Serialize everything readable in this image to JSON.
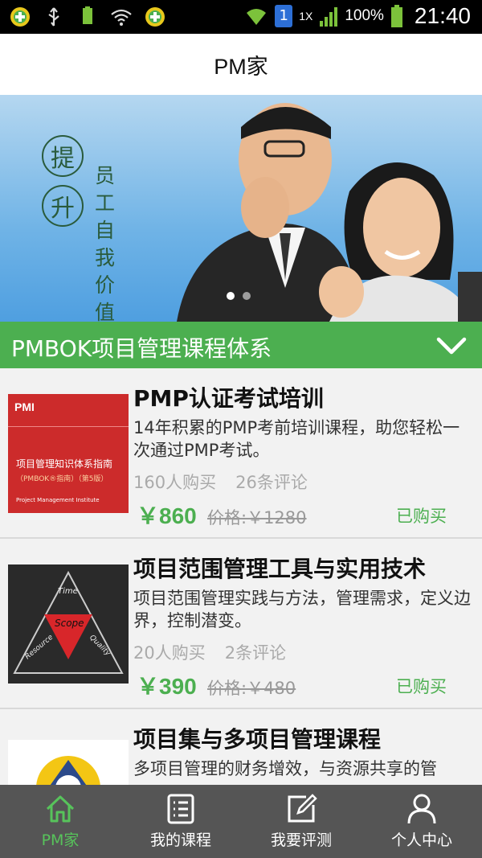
{
  "status_bar": {
    "battery_pct": "100%",
    "time": "21:40",
    "network": "1X",
    "sim": "1",
    "small_battery_label": "100%"
  },
  "header": {
    "title": "PM家"
  },
  "banner": {
    "circle_chars": [
      "提",
      "升"
    ],
    "vertical_chars": [
      "员",
      "工",
      "自",
      "我",
      "价",
      "值"
    ],
    "slide_count": 2,
    "active_slide": 0
  },
  "section": {
    "title": "PMBOK项目管理课程体系"
  },
  "courses": [
    {
      "title": "PMP认证考试培训",
      "description": "14年积累的PMP考前培训课程，助您轻松一次通过PMP考试。",
      "buyers": "160人购买",
      "reviews": "26条评论",
      "price": "￥860",
      "original_price": "价格:￥1280",
      "status": "已购买",
      "thumb": {
        "logo": "PMI",
        "title": "项目管理知识体系指南",
        "subtitle": "（PMBOK®指南）（第5版）",
        "publisher": "Project Management Institute"
      }
    },
    {
      "title": "项目范围管理工具与实用技术",
      "description": "项目范围管理实践与方法，管理需求，定义边界，控制潜变。",
      "buyers": "20人购买",
      "reviews": "2条评论",
      "price": "￥390",
      "original_price": "价格:￥480",
      "status": "已购买",
      "thumb": {
        "labels": [
          "Time",
          "Scope",
          "Resource",
          "Quality"
        ]
      }
    },
    {
      "title": "项目集与多项目管理课程",
      "description": "多项目管理的财务增效，与资源共享的管",
      "buyers": "",
      "reviews": "",
      "price": "",
      "original_price": "",
      "status": "",
      "thumb": {}
    }
  ],
  "bottom_nav": [
    {
      "label": "PM家",
      "icon": "home-icon",
      "active": true
    },
    {
      "label": "我的课程",
      "icon": "list-icon",
      "active": false
    },
    {
      "label": "我要评测",
      "icon": "edit-icon",
      "active": false
    },
    {
      "label": "个人中心",
      "icon": "person-icon",
      "active": false
    }
  ],
  "colors": {
    "accent": "#4caf50",
    "nav_active": "#57c35b",
    "nav_bg": "#555555",
    "status_bar": "#000000"
  }
}
